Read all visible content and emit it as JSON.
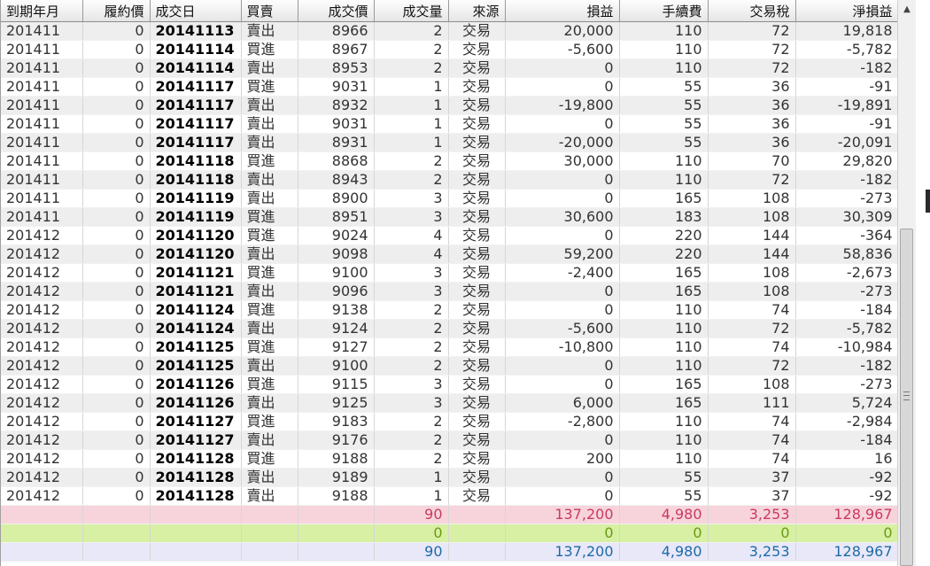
{
  "columns": [
    "到期年月",
    "履約價",
    "成交日",
    "買賣",
    "成交價",
    "成交量",
    "來源",
    "損益",
    "手續費",
    "交易稅",
    "淨損益"
  ],
  "rows": [
    [
      "201411",
      "0",
      "20141113",
      "賣出",
      "8966",
      "2",
      "交易",
      "20,000",
      "110",
      "72",
      "19,818"
    ],
    [
      "201411",
      "0",
      "20141114",
      "買進",
      "8967",
      "2",
      "交易",
      "-5,600",
      "110",
      "72",
      "-5,782"
    ],
    [
      "201411",
      "0",
      "20141114",
      "賣出",
      "8953",
      "2",
      "交易",
      "0",
      "110",
      "72",
      "-182"
    ],
    [
      "201411",
      "0",
      "20141117",
      "買進",
      "9031",
      "1",
      "交易",
      "0",
      "55",
      "36",
      "-91"
    ],
    [
      "201411",
      "0",
      "20141117",
      "賣出",
      "8932",
      "1",
      "交易",
      "-19,800",
      "55",
      "36",
      "-19,891"
    ],
    [
      "201411",
      "0",
      "20141117",
      "賣出",
      "9031",
      "1",
      "交易",
      "0",
      "55",
      "36",
      "-91"
    ],
    [
      "201411",
      "0",
      "20141117",
      "賣出",
      "8931",
      "1",
      "交易",
      "-20,000",
      "55",
      "36",
      "-20,091"
    ],
    [
      "201411",
      "0",
      "20141118",
      "買進",
      "8868",
      "2",
      "交易",
      "30,000",
      "110",
      "70",
      "29,820"
    ],
    [
      "201411",
      "0",
      "20141118",
      "賣出",
      "8943",
      "2",
      "交易",
      "0",
      "110",
      "72",
      "-182"
    ],
    [
      "201411",
      "0",
      "20141119",
      "賣出",
      "8900",
      "3",
      "交易",
      "0",
      "165",
      "108",
      "-273"
    ],
    [
      "201411",
      "0",
      "20141119",
      "買進",
      "8951",
      "3",
      "交易",
      "30,600",
      "183",
      "108",
      "30,309"
    ],
    [
      "201412",
      "0",
      "20141120",
      "買進",
      "9024",
      "4",
      "交易",
      "0",
      "220",
      "144",
      "-364"
    ],
    [
      "201412",
      "0",
      "20141120",
      "賣出",
      "9098",
      "4",
      "交易",
      "59,200",
      "220",
      "144",
      "58,836"
    ],
    [
      "201412",
      "0",
      "20141121",
      "買進",
      "9100",
      "3",
      "交易",
      "-2,400",
      "165",
      "108",
      "-2,673"
    ],
    [
      "201412",
      "0",
      "20141121",
      "賣出",
      "9096",
      "3",
      "交易",
      "0",
      "165",
      "108",
      "-273"
    ],
    [
      "201412",
      "0",
      "20141124",
      "買進",
      "9138",
      "2",
      "交易",
      "0",
      "110",
      "74",
      "-184"
    ],
    [
      "201412",
      "0",
      "20141124",
      "賣出",
      "9124",
      "2",
      "交易",
      "-5,600",
      "110",
      "72",
      "-5,782"
    ],
    [
      "201412",
      "0",
      "20141125",
      "買進",
      "9127",
      "2",
      "交易",
      "-10,800",
      "110",
      "74",
      "-10,984"
    ],
    [
      "201412",
      "0",
      "20141125",
      "賣出",
      "9100",
      "2",
      "交易",
      "0",
      "110",
      "72",
      "-182"
    ],
    [
      "201412",
      "0",
      "20141126",
      "買進",
      "9115",
      "3",
      "交易",
      "0",
      "165",
      "108",
      "-273"
    ],
    [
      "201412",
      "0",
      "20141126",
      "賣出",
      "9125",
      "3",
      "交易",
      "6,000",
      "165",
      "111",
      "5,724"
    ],
    [
      "201412",
      "0",
      "20141127",
      "買進",
      "9183",
      "2",
      "交易",
      "-2,800",
      "110",
      "74",
      "-2,984"
    ],
    [
      "201412",
      "0",
      "20141127",
      "賣出",
      "9176",
      "2",
      "交易",
      "0",
      "110",
      "74",
      "-184"
    ],
    [
      "201412",
      "0",
      "20141128",
      "買進",
      "9188",
      "2",
      "交易",
      "200",
      "110",
      "74",
      "16"
    ],
    [
      "201412",
      "0",
      "20141128",
      "賣出",
      "9189",
      "1",
      "交易",
      "0",
      "55",
      "37",
      "-92"
    ],
    [
      "201412",
      "0",
      "20141128",
      "賣出",
      "9188",
      "1",
      "交易",
      "0",
      "55",
      "37",
      "-92"
    ]
  ],
  "summary": [
    {
      "volume": "90",
      "pnl": "137,200",
      "fee": "4,980",
      "tax": "3,253",
      "net": "128,967"
    },
    {
      "volume": "0",
      "pnl": "0",
      "fee": "0",
      "tax": "0",
      "net": "0"
    },
    {
      "volume": "90",
      "pnl": "137,200",
      "fee": "4,980",
      "tax": "3,253",
      "net": "128,967"
    }
  ],
  "colors": {
    "summary_row_1": "#f7d4dc",
    "summary_row_2": "#d7f0a3",
    "summary_row_3": "#e8e8f8",
    "summary_text_1": "#c83a5e",
    "summary_text_2": "#6b9a12",
    "summary_text_3": "#1e6aa8"
  },
  "icons": {
    "scroll_up": "▲"
  }
}
